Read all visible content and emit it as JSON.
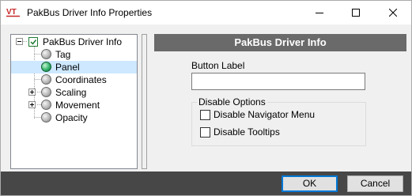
{
  "window": {
    "title": "PakBus Driver Info Properties",
    "app_icon_text": "VT",
    "controls": {
      "minimize": "minimize-icon",
      "maximize": "maximize-icon",
      "close": "close-icon"
    }
  },
  "tree": {
    "root": {
      "label": "PakBus Driver Info",
      "expanded": true,
      "icon": "checked-box-icon"
    },
    "items": [
      {
        "label": "Tag",
        "icon": "gray-circle-icon",
        "expandable": false,
        "selected": false
      },
      {
        "label": "Panel",
        "icon": "green-circle-icon",
        "expandable": false,
        "selected": true
      },
      {
        "label": "Coordinates",
        "icon": "gray-circle-icon",
        "expandable": false,
        "selected": false
      },
      {
        "label": "Scaling",
        "icon": "gray-circle-icon",
        "expandable": true,
        "selected": false
      },
      {
        "label": "Movement",
        "icon": "gray-circle-icon",
        "expandable": true,
        "selected": false
      },
      {
        "label": "Opacity",
        "icon": "gray-circle-icon",
        "expandable": false,
        "selected": false
      }
    ]
  },
  "panel": {
    "header": "PakBus Driver Info",
    "button_label": {
      "label": "Button Label",
      "value": ""
    },
    "disable_options": {
      "title": "Disable Options",
      "options": [
        {
          "label": "Disable Navigator Menu",
          "checked": false
        },
        {
          "label": "Disable Tooltips",
          "checked": false
        }
      ]
    }
  },
  "footer": {
    "ok_label": "OK",
    "cancel_label": "Cancel"
  },
  "colors": {
    "header_bg": "#6a6a6a",
    "footer_bg": "#474747",
    "selection": "#cde8ff",
    "accent": "#0078d7"
  }
}
